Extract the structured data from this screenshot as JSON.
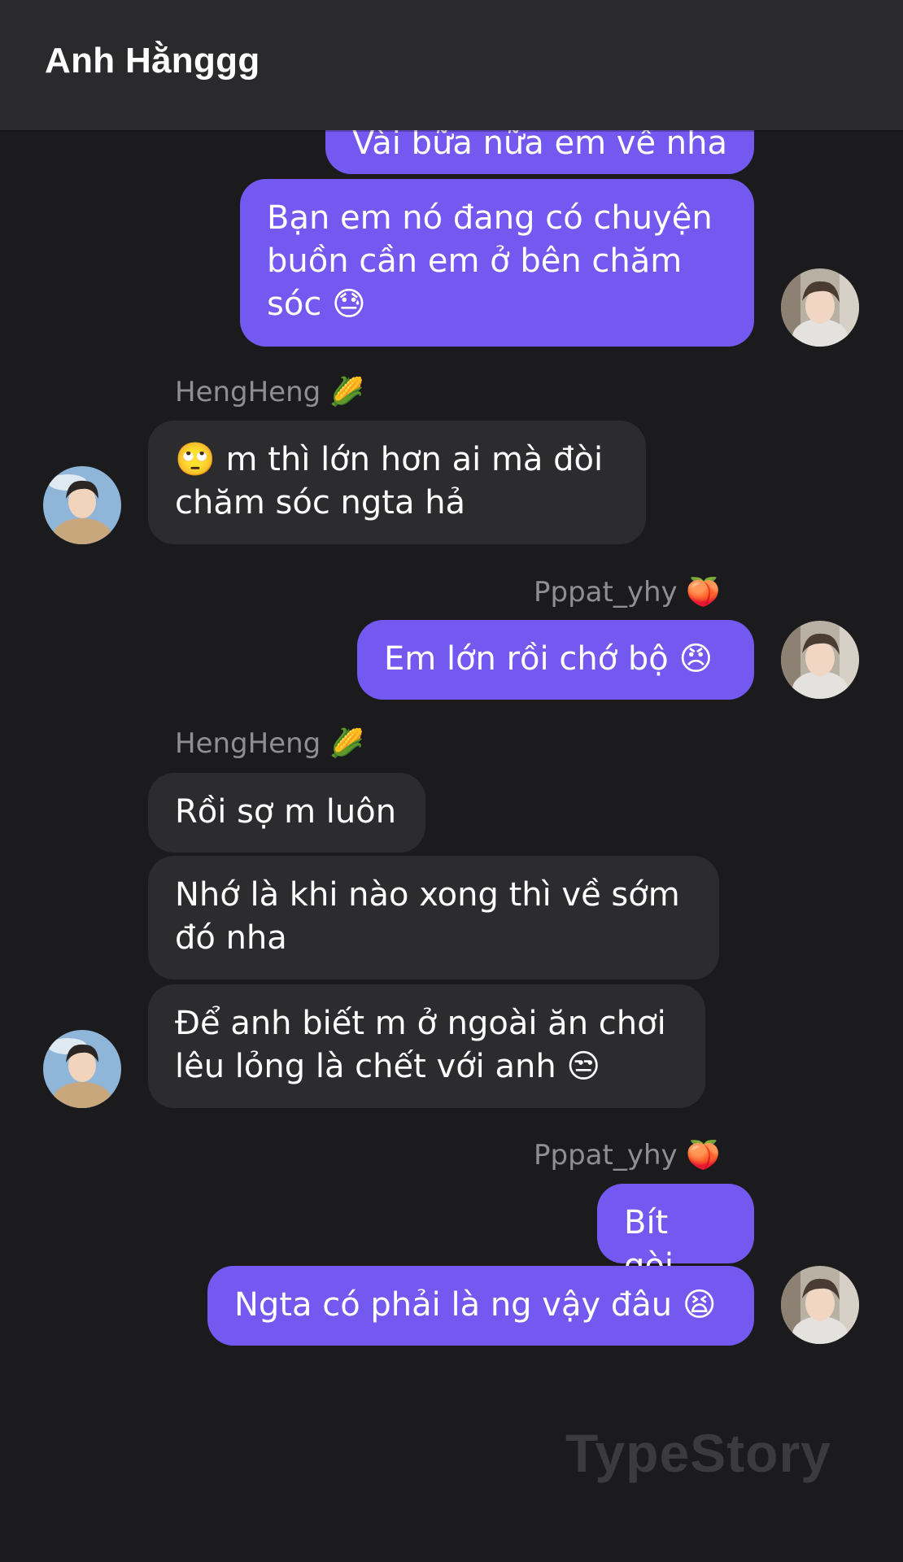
{
  "header": {
    "title": "Anh Hằnggg"
  },
  "senders": {
    "heng": "HengHeng 🌽",
    "pat": "Pppat_yhy 🍑"
  },
  "messages": [
    {
      "text": "Vài bữa nữa em về nha"
    },
    {
      "text": "Bạn em nó đang có chuyện\nbuồn cần em ở bên chăm\nsóc 😓"
    },
    {
      "text": "🙄 m thì lớn hơn ai mà đòi\nchăm sóc ngta hả"
    },
    {
      "text": "Em lớn rồi chớ bộ 😠"
    },
    {
      "text": "Rồi sợ m luôn"
    },
    {
      "text": "Nhớ là khi nào xong thì về sớm\nđó nha"
    },
    {
      "text": "Để anh biết m ở ngoài ăn chơi\nlêu lỏng là chết với anh 😒"
    },
    {
      "text": "Bít gòi"
    },
    {
      "text": "Ngta có phải là ng vậy đâu 😫"
    }
  ],
  "watermark": "TypeStory",
  "colors": {
    "outgoing_bubble": "#7359ef",
    "incoming_bubble": "#2c2c2e",
    "background": "#1b1b1d",
    "header": "#2a2a2c"
  }
}
